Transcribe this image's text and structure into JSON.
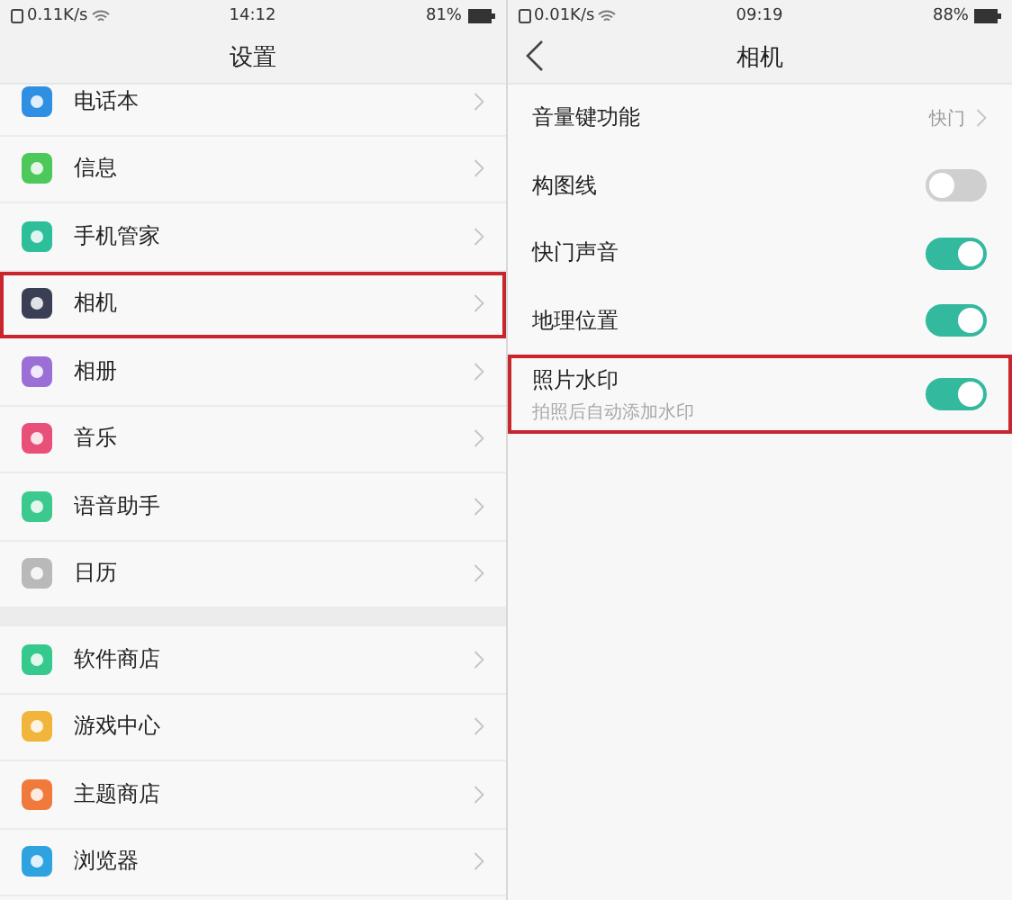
{
  "left_screen": {
    "status_bar": {
      "speed": "0.11K/s",
      "time": "14:12",
      "battery": "81%"
    },
    "title": "设置",
    "groups": [
      [
        {
          "label": "电话本",
          "color": "#2f8fe0",
          "highlighted": false
        },
        {
          "label": "信息",
          "color": "#4cc95a",
          "highlighted": false
        },
        {
          "label": "手机管家",
          "color": "#2cbf9a",
          "highlighted": false
        },
        {
          "label": "相机",
          "color": "#3a3f55",
          "highlighted": true
        },
        {
          "label": "相册",
          "color": "#9b6fd6",
          "highlighted": false
        },
        {
          "label": "音乐",
          "color": "#e8507a",
          "highlighted": false
        },
        {
          "label": "语音助手",
          "color": "#3cc98f",
          "highlighted": false
        },
        {
          "label": "日历",
          "color": "#b9b9b9",
          "highlighted": false
        }
      ],
      [
        {
          "label": "软件商店",
          "color": "#36c98e",
          "highlighted": false
        },
        {
          "label": "游戏中心",
          "color": "#f2b53c",
          "highlighted": false
        },
        {
          "label": "主题商店",
          "color": "#ef7a3c",
          "highlighted": false
        },
        {
          "label": "浏览器",
          "color": "#2fa3e0",
          "highlighted": false
        }
      ]
    ]
  },
  "right_screen": {
    "status_bar": {
      "speed": "0.01K/s",
      "time": "09:19",
      "battery": "88%"
    },
    "title": "相机",
    "rows": [
      {
        "kind": "value",
        "label": "音量键功能",
        "value": "快门",
        "highlighted": false
      },
      {
        "kind": "toggle",
        "label": "构图线",
        "on": false,
        "highlighted": false
      },
      {
        "kind": "toggle",
        "label": "快门声音",
        "on": true,
        "highlighted": false
      },
      {
        "kind": "toggle",
        "label": "地理位置",
        "on": true,
        "highlighted": false
      },
      {
        "kind": "toggle",
        "label": "照片水印",
        "subtitle": "拍照后自动添加水印",
        "on": true,
        "highlighted": true
      }
    ]
  }
}
